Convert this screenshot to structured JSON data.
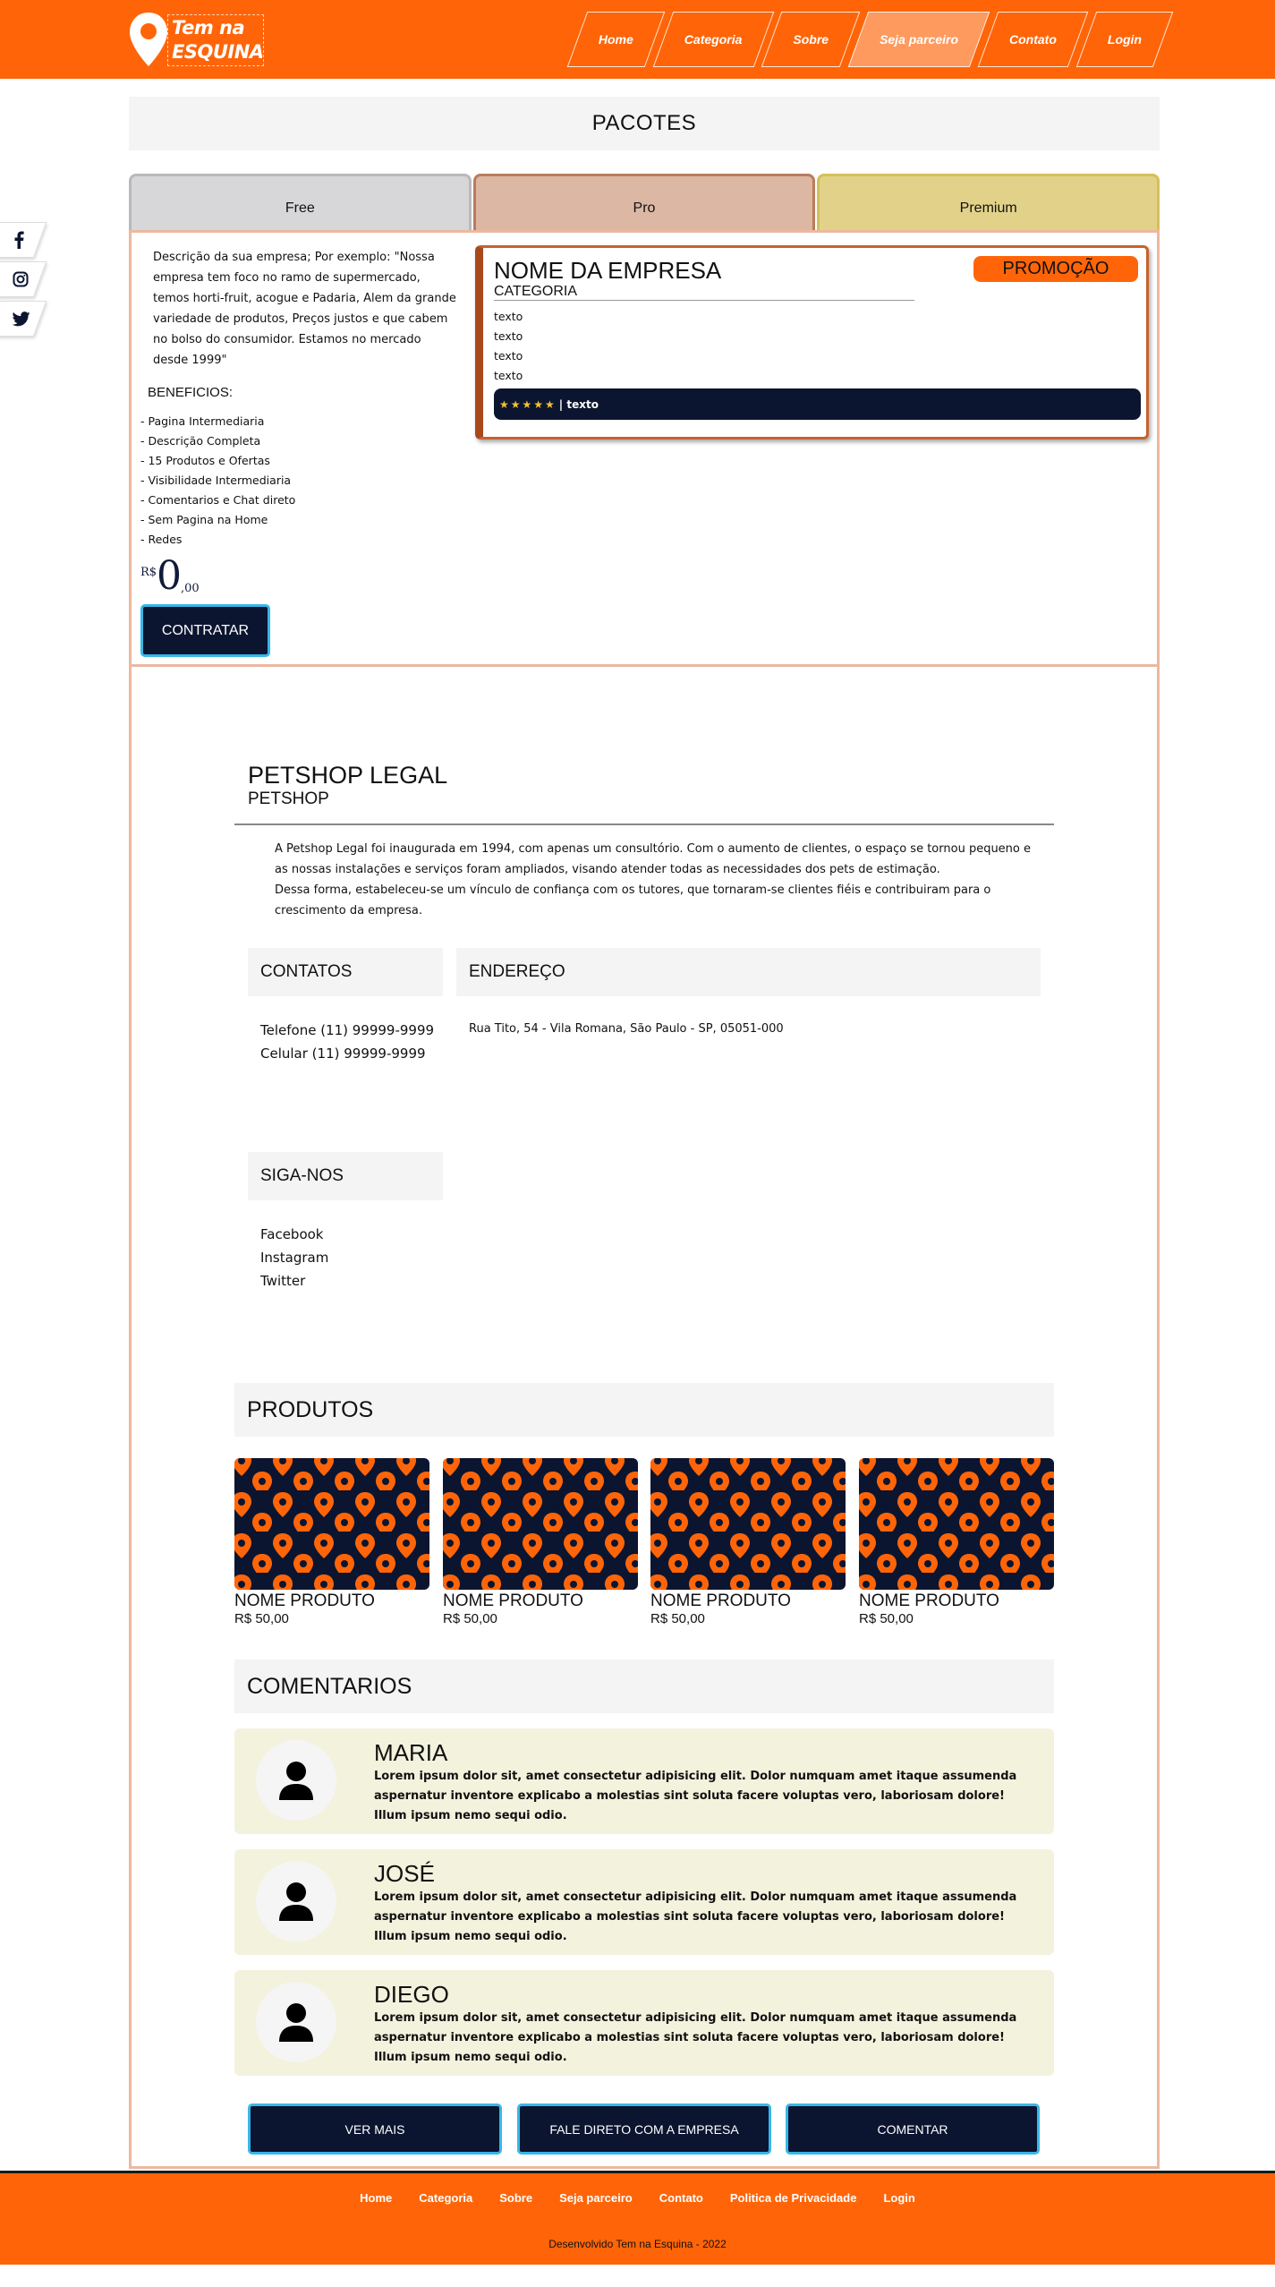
{
  "header": {
    "logo_line1": "Tem na",
    "logo_line2": "ESQUINA",
    "nav": [
      "Home",
      "Categoria",
      "Sobre",
      "Seja parceiro",
      "Contato",
      "Login"
    ],
    "active_nav": "Seja parceiro",
    "brand_color": "#ff6508"
  },
  "sidebar": {
    "icons": [
      "facebook-icon",
      "instagram-icon",
      "twitter-icon"
    ]
  },
  "pacotes": {
    "title": "PACOTES",
    "tabs": [
      "Free",
      "Pro",
      "Premium"
    ],
    "description": "Descrição da sua empresa; Por exemplo: \"Nossa empresa tem foco no ramo de supermercado, temos horti-fruit, acogue e Padaria, Alem da grande variedade de produtos, Preços justos e que cabem no bolso do consumidor. Estamos no mercado desde 1999\"",
    "benefits_title": "BENEFICIOS:",
    "benefits": [
      "- Pagina Intermediaria",
      "- Descrição Completa",
      "- 15 Produtos e Ofertas",
      "- Visibilidade Intermediaria",
      "- Comentarios e Chat direto",
      "- Sem Pagina na Home",
      "- Redes"
    ],
    "price_currency": "R$",
    "price_integer": "0",
    "price_cents": ",00",
    "button": "CONTRATAR"
  },
  "preview_card": {
    "name": "NOME DA EMPRESA",
    "category": "CATEGORIA",
    "texts": [
      "texto",
      "texto",
      "texto",
      "texto"
    ],
    "stars": "★★★★★",
    "bar_text": "| texto",
    "badge": "PROMOÇÃO"
  },
  "company": {
    "name": "PETSHOP LEGAL",
    "category": "PETSHOP",
    "about_1": "A Petshop Legal foi inaugurada em 1994, com apenas um consultório. Com o aumento de clientes, o espaço se tornou pequeno e as nossas instalações e serviços foram ampliados, visando atender todas as necessidades dos pets de estimação.",
    "about_2": "Dessa forma, estabeleceu-se um vínculo de confiança com os tutores, que tornaram-se clientes fiéis e contribuiram para o crescimento da empresa.",
    "contatos_title": "CONTATOS",
    "phone": "Telefone (11) 99999-9999",
    "mobile": "Celular (11) 99999-9999",
    "endereco_title": "ENDEREÇO",
    "address": "Rua Tito, 54 - Vila Romana, São Paulo - SP, 05051-000",
    "siga_title": "SIGA-NOS",
    "social_links": [
      "Facebook",
      "Instagram",
      "Twitter"
    ]
  },
  "produtos": {
    "title": "PRODUTOS",
    "items": [
      {
        "name": "NOME PRODUTO",
        "price": "R$ 50,00"
      },
      {
        "name": "NOME PRODUTO",
        "price": "R$ 50,00"
      },
      {
        "name": "NOME PRODUTO",
        "price": "R$ 50,00"
      },
      {
        "name": "NOME PRODUTO",
        "price": "R$ 50,00"
      }
    ]
  },
  "comentarios": {
    "title": "COMENTARIOS",
    "items": [
      {
        "name": "MARIA",
        "text": "Lorem ipsum dolor sit, amet consectetur adipisicing elit. Dolor numquam amet itaque assumenda aspernatur inventore explicabo a molestias sint soluta facere voluptas vero, laboriosam dolore! Illum ipsum nemo sequi odio."
      },
      {
        "name": "JOSÉ",
        "text": "Lorem ipsum dolor sit, amet consectetur adipisicing elit. Dolor numquam amet itaque assumenda aspernatur inventore explicabo a molestias sint soluta facere voluptas vero, laboriosam dolore! Illum ipsum nemo sequi odio."
      },
      {
        "name": "DIEGO",
        "text": "Lorem ipsum dolor sit, amet consectetur adipisicing elit. Dolor numquam amet itaque assumenda aspernatur inventore explicabo a molestias sint soluta facere voluptas vero, laboriosam dolore! Illum ipsum nemo sequi odio."
      }
    ]
  },
  "actions": {
    "ver_mais": "VER MAIS",
    "fale": "FALE DIRETO COM A EMPRESA",
    "comentar": "COMENTAR"
  },
  "footer": {
    "nav": [
      "Home",
      "Categoria",
      "Sobre",
      "Seja parceiro",
      "Contato",
      "Politica de Privacidade",
      "Login"
    ],
    "copyright": "Desenvolvido Tem na Esquina - 2022"
  }
}
